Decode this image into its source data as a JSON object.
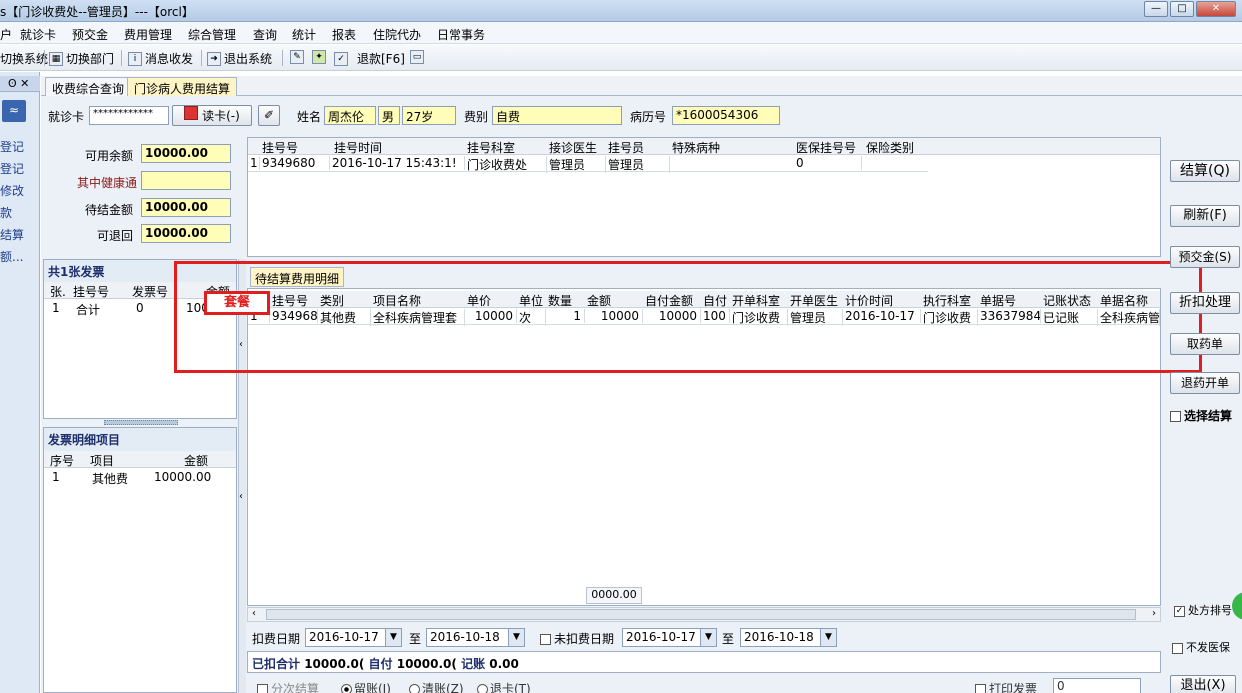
{
  "window": {
    "title": "s【门诊收费处--管理员】---【orcl】",
    "min": "—",
    "max": "□",
    "close": "✕"
  },
  "menu": [
    "户",
    "就诊卡",
    "预交金",
    "费用管理",
    "综合管理",
    "查询",
    "统计",
    "报表",
    "住院代办",
    "日常事务"
  ],
  "toolbar": {
    "switch_system": "切换系统",
    "switch_dept": "切换部门",
    "message": "消息收发",
    "logout": "退出系统",
    "refund": "退款[F6]"
  },
  "nav": {
    "pin": "ʘ ✕",
    "collapse": "≈",
    "items": [
      "登记",
      "登记",
      "修改",
      "款",
      "结算",
      "额..."
    ]
  },
  "tabs": [
    "收费综合查询",
    "门诊病人费用结算"
  ],
  "patient": {
    "card_label": "就诊卡",
    "card_value": "************",
    "read_card": "读卡(-)",
    "name_label": "姓名",
    "name": "周杰伦",
    "gender": "男",
    "age": "27岁",
    "fee_type_label": "费别",
    "fee_type": "自费",
    "record_label": "病历号",
    "record_no": "*1600054306"
  },
  "balance": {
    "available_label": "可用余额",
    "available": "10000.00",
    "health_label": "其中健康通",
    "health": "",
    "pending_label": "待结金额",
    "pending": "10000.00",
    "refundable_label": "可退回",
    "refundable": "10000.00"
  },
  "registration": {
    "columns": [
      "挂号号",
      "挂号时间",
      "挂号科室",
      "接诊医生",
      "挂号员",
      "特殊病种",
      "医保挂号号",
      "保险类别"
    ],
    "rows": [
      {
        "idx": "1",
        "no": "9349680",
        "time": "2016-10-17 15:43:1!",
        "dept": "门诊收费处",
        "doctor": "管理员",
        "clerk": "管理员",
        "disease": "",
        "insurance_no": "0",
        "insurance_type": ""
      }
    ]
  },
  "invoice": {
    "title": "共1张发票",
    "columns": [
      "张.",
      "挂号号",
      "发票号",
      "金额"
    ],
    "rows": [
      {
        "idx": "1",
        "no": "合计",
        "invoice": "0",
        "amount": "100..."
      }
    ]
  },
  "invoice_detail": {
    "title": "发票明细项目",
    "columns": [
      "序号",
      "项目",
      "金额"
    ],
    "rows": [
      {
        "idx": "1",
        "item": "其他费",
        "amount": "10000.00"
      }
    ]
  },
  "pending_fees": {
    "tab": "待结算费用明细",
    "package_label": "套餐",
    "columns": [
      "挂号号",
      "类别",
      "项目名称",
      "单价",
      "单位",
      "数量",
      "金额",
      "自付金额",
      "自付",
      "开单科室",
      "开单医生",
      "计价时间",
      "执行科室",
      "单据号",
      "记账状态",
      "单据名称"
    ],
    "rows": [
      {
        "idx": "1",
        "no": "934968(",
        "category": "其他费",
        "item": "全科疾病管理套",
        "price": "10000",
        "unit": "次",
        "qty": "1",
        "amount": "10000",
        "self_amount": "10000",
        "self_pct": "100",
        "dept": "门诊收费",
        "doctor": "管理员",
        "time": "2016-10-17",
        "exec_dept": "门诊收费",
        "doc_no": "33637984",
        "status": "已记账",
        "doc_name": "全科疾病管"
      }
    ],
    "total": "0000.00"
  },
  "filters": {
    "deduct_date_label": "扣费日期",
    "deduct_from": "2016-10-17",
    "to_label": "至",
    "deduct_to": "2016-10-18",
    "undeducted_label": "未扣费日期",
    "undeducted_from": "2016-10-17",
    "undeducted_to": "2016-10-18"
  },
  "summary": {
    "deducted_label": "已扣合计",
    "deducted": "10000.0(",
    "self_label": "自付",
    "self": "10000.0(",
    "account_label": "记账",
    "account": "0.00"
  },
  "bottom": {
    "split": "分次结算",
    "keep": "留账(I)",
    "clear": "清账(Z)",
    "return_card": "退卡(T)",
    "print_invoice": "打印发票",
    "print_count": "0"
  },
  "actions": {
    "settle": "结算(Q)",
    "refresh": "刷新(F)",
    "prepay": "预交金(S)",
    "discount": "折扣处理",
    "cancel_med": "取药单",
    "return_med": "退药开单",
    "select_settle": "选择结算",
    "rx_queue": "处方排号",
    "no_insurance": "不发医保",
    "exit": "退出(X)"
  }
}
